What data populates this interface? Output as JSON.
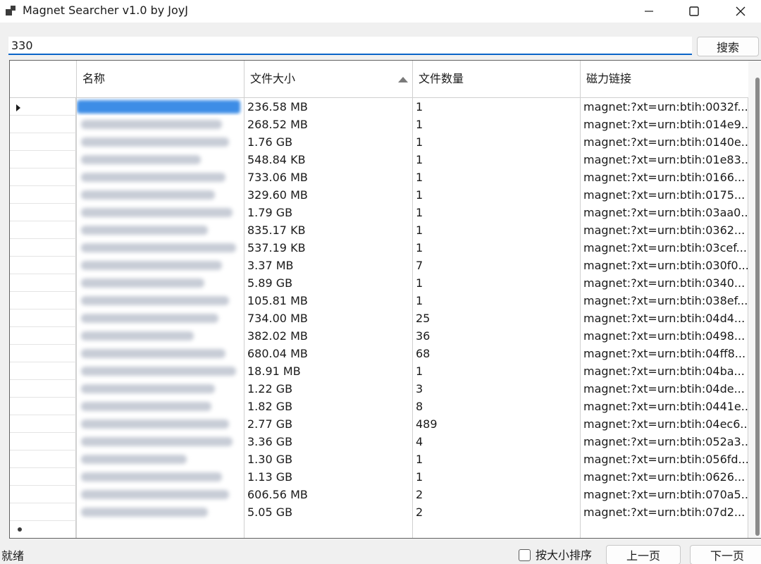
{
  "window": {
    "title": "Magnet Searcher v1.0 by JoyJ"
  },
  "search": {
    "value": "330",
    "button_label": "搜索"
  },
  "grid": {
    "columns": [
      {
        "label": "名称"
      },
      {
        "label": "文件大小",
        "sorted": "ascending"
      },
      {
        "label": "文件数量"
      },
      {
        "label": "磁力链接"
      }
    ],
    "rows": [
      {
        "size": "236.58 MB",
        "count": "1",
        "magnet": "magnet:?xt=urn:btih:0032f..."
      },
      {
        "size": "268.52 MB",
        "count": "1",
        "magnet": "magnet:?xt=urn:btih:014e9..."
      },
      {
        "size": "1.76 GB",
        "count": "1",
        "magnet": "magnet:?xt=urn:btih:0140e..."
      },
      {
        "size": "548.84 KB",
        "count": "1",
        "magnet": "magnet:?xt=urn:btih:01e83..."
      },
      {
        "size": "733.06 MB",
        "count": "1",
        "magnet": "magnet:?xt=urn:btih:0166..."
      },
      {
        "size": "329.60 MB",
        "count": "1",
        "magnet": "magnet:?xt=urn:btih:0175..."
      },
      {
        "size": "1.79 GB",
        "count": "1",
        "magnet": "magnet:?xt=urn:btih:03aa0..."
      },
      {
        "size": "835.17 KB",
        "count": "1",
        "magnet": "magnet:?xt=urn:btih:0362..."
      },
      {
        "size": "537.19 KB",
        "count": "1",
        "magnet": "magnet:?xt=urn:btih:03cef..."
      },
      {
        "size": "3.37 MB",
        "count": "7",
        "magnet": "magnet:?xt=urn:btih:030f0..."
      },
      {
        "size": "5.89 GB",
        "count": "1",
        "magnet": "magnet:?xt=urn:btih:0340..."
      },
      {
        "size": "105.81 MB",
        "count": "1",
        "magnet": "magnet:?xt=urn:btih:038ef..."
      },
      {
        "size": "734.00 MB",
        "count": "25",
        "magnet": "magnet:?xt=urn:btih:04d4..."
      },
      {
        "size": "382.02 MB",
        "count": "36",
        "magnet": "magnet:?xt=urn:btih:0498..."
      },
      {
        "size": "680.04 MB",
        "count": "68",
        "magnet": "magnet:?xt=urn:btih:04ff8..."
      },
      {
        "size": "18.91 MB",
        "count": "1",
        "magnet": "magnet:?xt=urn:btih:04ba..."
      },
      {
        "size": "1.22 GB",
        "count": "3",
        "magnet": "magnet:?xt=urn:btih:04de..."
      },
      {
        "size": "1.82 GB",
        "count": "8",
        "magnet": "magnet:?xt=urn:btih:0441e..."
      },
      {
        "size": "2.77 GB",
        "count": "489",
        "magnet": "magnet:?xt=urn:btih:04ec6..."
      },
      {
        "size": "3.36 GB",
        "count": "4",
        "magnet": "magnet:?xt=urn:btih:052a3..."
      },
      {
        "size": "1.30 GB",
        "count": "1",
        "magnet": "magnet:?xt=urn:btih:056fd..."
      },
      {
        "size": "1.13 GB",
        "count": "1",
        "magnet": "magnet:?xt=urn:btih:0626..."
      },
      {
        "size": "606.56 MB",
        "count": "2",
        "magnet": "magnet:?xt=urn:btih:070a5..."
      },
      {
        "size": "5.05 GB",
        "count": "2",
        "magnet": "magnet:?xt=urn:btih:07d2..."
      }
    ]
  },
  "status": {
    "text": "就绪",
    "sort_checkbox_label": "按大小排序",
    "sort_checked": false,
    "prev_label": "上一页",
    "next_label": "下一页"
  },
  "colors": {
    "accent": "#0a64c8",
    "selection": "#3d8de6"
  },
  "icons": {
    "app": "app-window-icon",
    "minimize": "minimize-icon",
    "maximize": "maximize-icon",
    "close": "close-icon",
    "sort": "sort-ascending-icon",
    "row_pointer": "row-pointer-icon"
  }
}
